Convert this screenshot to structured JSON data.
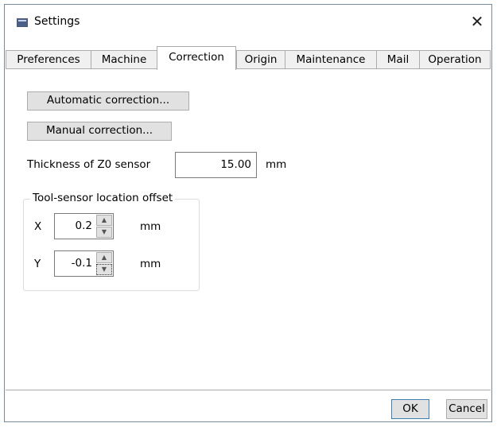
{
  "window": {
    "title": "Settings",
    "close_glyph": "✕",
    "icon": "settings-window-icon"
  },
  "tabs": [
    {
      "label": "Preferences"
    },
    {
      "label": "Machine"
    },
    {
      "label": "Correction",
      "active": true
    },
    {
      "label": "Origin"
    },
    {
      "label": "Maintenance"
    },
    {
      "label": "Mail"
    },
    {
      "label": "Operation"
    }
  ],
  "correction": {
    "auto_button": "Automatic correction...",
    "manual_button": "Manual correction...",
    "thickness": {
      "label": "Thickness of Z0 sensor",
      "value": "15.00",
      "unit": "mm"
    },
    "offset_group": {
      "title": "Tool-sensor location offset",
      "x": {
        "label": "X",
        "value": "0.2",
        "unit": "mm"
      },
      "y": {
        "label": "Y",
        "value": "-0.1",
        "unit": "mm"
      }
    }
  },
  "footer": {
    "ok": "OK",
    "cancel": "Cancel"
  },
  "colors": {
    "accent": "#3c7fb1",
    "button_face": "#e1e1e1",
    "border": "#acacac"
  }
}
